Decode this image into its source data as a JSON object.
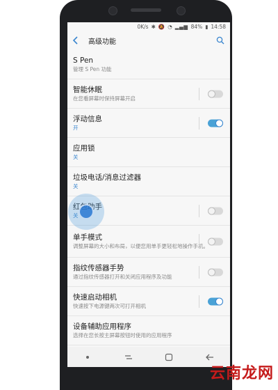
{
  "statusbar": {
    "network_speed": "0K/s",
    "battery": "84%",
    "time": "14:58"
  },
  "appbar": {
    "title": "高级功能"
  },
  "items": [
    {
      "title": "S Pen",
      "subtitle": "管理 S Pen 功能",
      "toggle": null,
      "sub_style": "gray"
    },
    {
      "title": "智能休眠",
      "subtitle": "在您看屏幕时保持屏幕开启",
      "toggle": "off",
      "sub_style": "gray"
    },
    {
      "title": "浮动信息",
      "subtitle": "开",
      "toggle": "on",
      "sub_style": "blue"
    },
    {
      "title": "应用锁",
      "subtitle": "关",
      "toggle": null,
      "sub_style": "blue"
    },
    {
      "title": "垃圾电话/消息过滤器",
      "subtitle": "关",
      "toggle": null,
      "sub_style": "blue"
    },
    {
      "title": "红包助手",
      "subtitle": "关",
      "toggle": "off",
      "sub_style": "blue"
    },
    {
      "title": "单手模式",
      "subtitle": "调整屏幕的大小和布局，以便您用单手更轻松地操作手机。",
      "toggle": "off",
      "sub_style": "gray"
    },
    {
      "title": "指纹传感器手势",
      "subtitle": "通过指纹传感器打开和关闭应用程序及功能",
      "toggle": "off",
      "sub_style": "gray"
    },
    {
      "title": "快速启动相机",
      "subtitle": "快速按下电源键两次可打开相机",
      "toggle": "on",
      "sub_style": "gray"
    },
    {
      "title": "设备辅助应用程序",
      "subtitle": "选择在您长按主屏幕按钮时使用的应用程序",
      "toggle": null,
      "sub_style": "gray"
    }
  ],
  "watermark": "云南龙网",
  "colors": {
    "accent": "#3a86cf",
    "toggle_on": "#4aa2d6",
    "watermark": "#c51b1b"
  }
}
